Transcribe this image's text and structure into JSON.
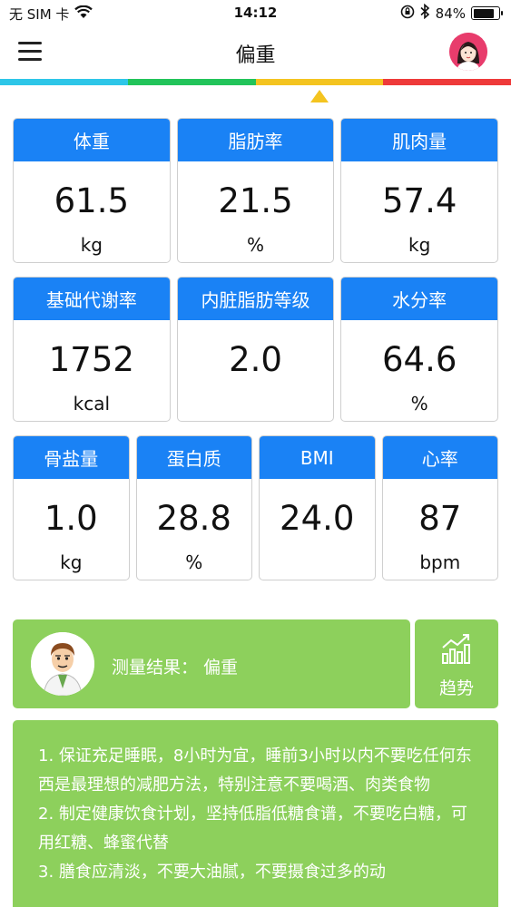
{
  "status": {
    "carrier": "无 SIM 卡",
    "time": "14:12",
    "battery_percent": "84%",
    "battery_level": 0.84
  },
  "nav": {
    "title": "偏重"
  },
  "bmi_scale": {
    "colors": [
      "#2dc6e8",
      "#22c45a",
      "#f4c420",
      "#ee3a3a"
    ],
    "indicator_color": "#f4c420"
  },
  "metrics": {
    "weight": {
      "label": "体重",
      "value": "61.5",
      "unit": "kg"
    },
    "body_fat": {
      "label": "脂肪率",
      "value": "21.5",
      "unit": "%"
    },
    "muscle": {
      "label": "肌肉量",
      "value": "57.4",
      "unit": "kg"
    },
    "bmr": {
      "label": "基础代谢率",
      "value": "1752",
      "unit": "kcal"
    },
    "visceral_fat": {
      "label": "内脏脂肪等级",
      "value": "2.0",
      "unit": ""
    },
    "water": {
      "label": "水分率",
      "value": "64.6",
      "unit": "%"
    },
    "bone": {
      "label": "骨盐量",
      "value": "1.0",
      "unit": "kg"
    },
    "protein": {
      "label": "蛋白质",
      "value": "28.8",
      "unit": "%"
    },
    "bmi": {
      "label": "BMI",
      "value": "24.0",
      "unit": ""
    },
    "heart_rate": {
      "label": "心率",
      "value": "87",
      "unit": "bpm"
    }
  },
  "colors": {
    "card_header": "#1a82f5",
    "panel_green": "#8dd05c"
  },
  "result": {
    "text": "测量结果：  偏重"
  },
  "trend": {
    "label": "趋势"
  },
  "advice": {
    "items": [
      "1. 保证充足睡眠，8小时为宜，睡前3小时以内不要吃任何东西是最理想的减肥方法，特别注意不要喝酒、肉类食物",
      "2. 制定健康饮食计划，坚持低脂低糖食谱，不要吃白糖，可用红糖、蜂蜜代替",
      "3. 膳食应清淡，不要大油腻，不要摄食过多的动"
    ]
  }
}
